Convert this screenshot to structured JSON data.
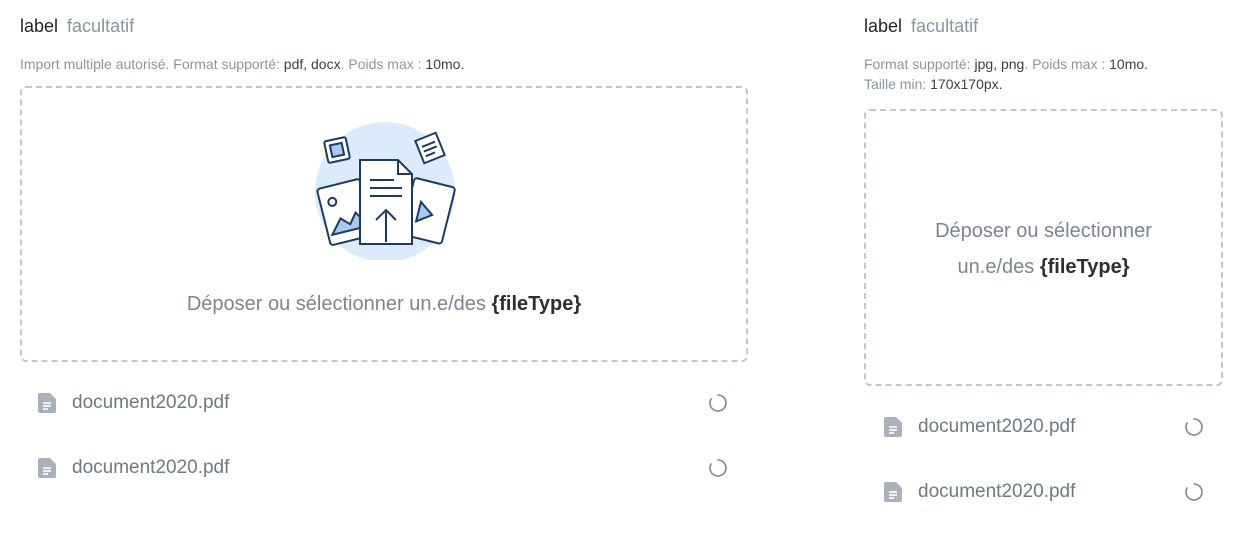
{
  "uploader_multi": {
    "label": "label",
    "optional": "facultatif",
    "hint": {
      "prefix": "Import multiple autorisé. Format supporté: ",
      "formats": "pdf, docx",
      "mid": ". Poids max : ",
      "max_size": "10mo."
    },
    "drop_text": "Déposer ou sélectionner un.e/des ",
    "drop_placeholder": "{fileType}",
    "files": [
      {
        "name": "document2020.pdf",
        "status": "loading"
      },
      {
        "name": "document2020.pdf",
        "status": "loading"
      }
    ]
  },
  "uploader_image": {
    "label": "label",
    "optional": "facultatif",
    "hint": {
      "prefix": "Format supporté: ",
      "formats": "jpg, png",
      "mid": ". Poids max : ",
      "max_size": "10mo.",
      "size_min_label": "Taille min: ",
      "size_min": "170x170px."
    },
    "drop_text": "Déposer ou sélectionner un.e/des ",
    "drop_placeholder": "{fileType}",
    "files": [
      {
        "name": "document2020.pdf",
        "status": "loading"
      },
      {
        "name": "document2020.pdf",
        "status": "loading"
      }
    ]
  },
  "icons": {
    "file": "file-text-icon",
    "spinner": "loading-spinner-icon",
    "illustration": "upload-documents-illustration"
  },
  "colors": {
    "accent_bg": "#dcebfb",
    "icon_stroke": "#1e3a5f",
    "muted_text": "#8a949f",
    "dash_border": "#c2c7cd"
  }
}
